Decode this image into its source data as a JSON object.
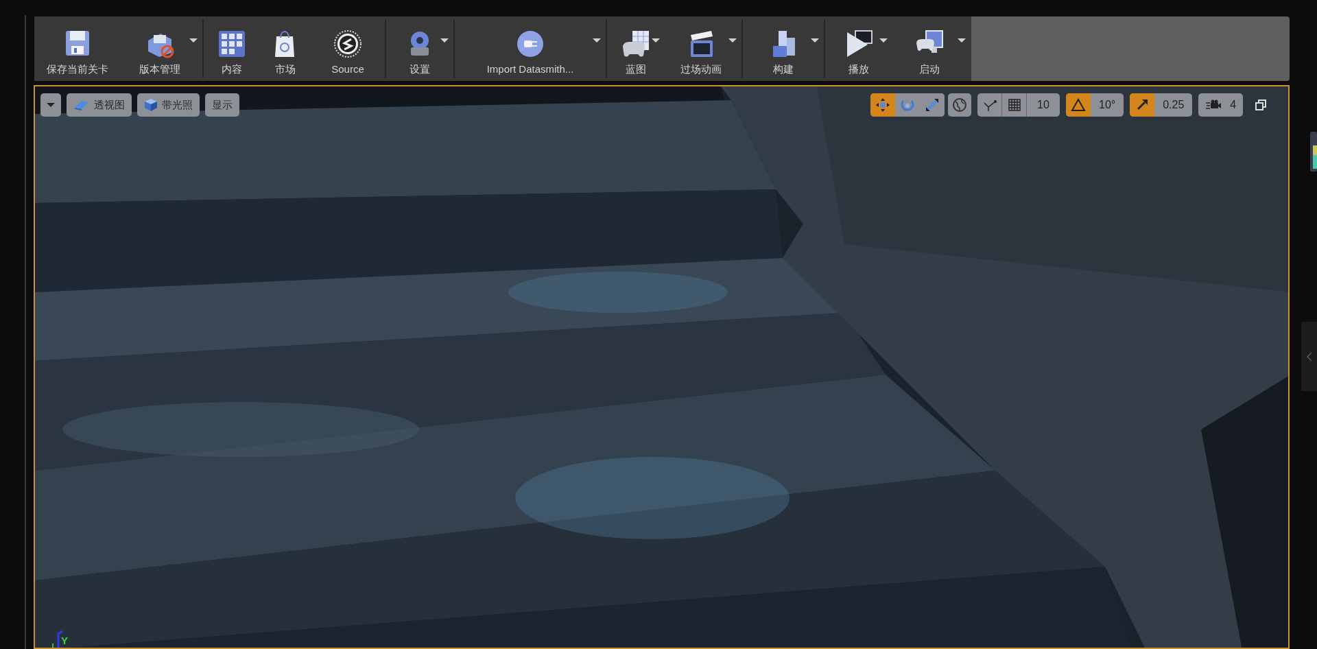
{
  "toolbar": {
    "groups": [
      {
        "buttons": [
          {
            "label": "保存当前关卡",
            "dropdown": false
          },
          {
            "label": "版本管理",
            "dropdown": true
          }
        ]
      },
      {
        "buttons": [
          {
            "label": "内容",
            "dropdown": false
          },
          {
            "label": "市场",
            "dropdown": false
          },
          {
            "label": "Source",
            "dropdown": false
          }
        ]
      },
      {
        "buttons": [
          {
            "label": "设置",
            "dropdown": true
          }
        ]
      },
      {
        "buttons": [
          {
            "label": "Import Datasmith...",
            "dropdown": true
          }
        ]
      },
      {
        "buttons": [
          {
            "label": "蓝图",
            "dropdown": true
          },
          {
            "label": "过场动画",
            "dropdown": true
          }
        ]
      },
      {
        "buttons": [
          {
            "label": "构建",
            "dropdown": true
          }
        ]
      },
      {
        "buttons": [
          {
            "label": "播放",
            "dropdown": true
          },
          {
            "label": "启动",
            "dropdown": true
          }
        ]
      }
    ]
  },
  "viewport": {
    "view_buttons": [
      "透视图",
      "带光照",
      "显示"
    ],
    "transform_tools": [
      {
        "selected": true
      },
      {
        "selected": false
      },
      {
        "selected": false
      }
    ],
    "snaps": [
      {
        "value": "10",
        "on": false
      },
      {
        "value": "10°",
        "on": true
      },
      {
        "value": "0.25",
        "on": true
      }
    ],
    "camera_speed": "4",
    "axis_label": "Y"
  }
}
